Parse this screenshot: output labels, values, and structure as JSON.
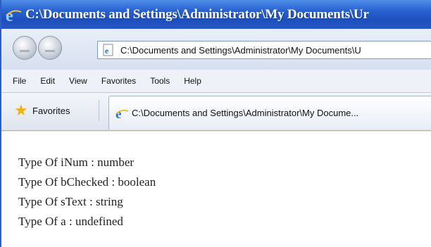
{
  "window": {
    "title": "C:\\Documents and Settings\\Administrator\\My Documents\\Ur"
  },
  "address": {
    "value": "C:\\Documents and Settings\\Administrator\\My Documents\\U"
  },
  "menu": {
    "items": [
      "File",
      "Edit",
      "View",
      "Favorites",
      "Tools",
      "Help"
    ]
  },
  "favorites": {
    "label": "Favorites"
  },
  "tab": {
    "label": "C:\\Documents and Settings\\Administrator\\My Docume..."
  },
  "content": {
    "lines": [
      "Type Of iNum : number",
      "Type Of bChecked : boolean",
      "Type Of sText : string",
      "Type Of a : undefined"
    ]
  },
  "icons": {
    "title": "ie-logo-icon",
    "address": "page-icon",
    "favorites": "star-icon",
    "tab": "ie-logo-icon"
  },
  "colors": {
    "titlebar": "#2a63d2",
    "ie_blue": "#1b6fd0",
    "star": "#f2b10c"
  }
}
